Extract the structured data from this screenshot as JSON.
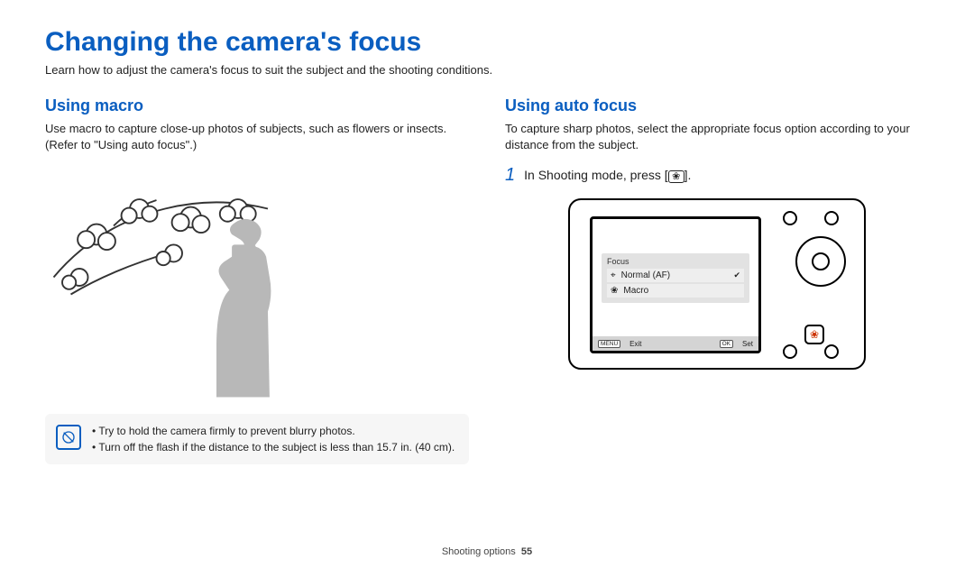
{
  "page": {
    "title": "Changing the camera's focus",
    "subtitle": "Learn how to adjust the camera's focus to suit the subject and the shooting conditions."
  },
  "left": {
    "heading": "Using macro",
    "body": "Use macro to capture close-up photos of subjects, such as flowers or insects. (Refer to \"Using auto focus\".)",
    "tips": [
      "Try to hold the camera firmly to prevent blurry photos.",
      "Turn off the flash if the distance to the subject is less than 15.7 in. (40 cm)."
    ]
  },
  "right": {
    "heading": "Using auto focus",
    "body": "To capture sharp photos, select the appropriate focus option according to your distance from the subject.",
    "step_number": "1",
    "step_text_before": "In Shooting mode, press [",
    "step_text_after": "].",
    "focus_icon_glyph": "❀"
  },
  "camera": {
    "menu_title": "Focus",
    "options": [
      {
        "icon": "⌖",
        "label": "Normal (AF)",
        "selected": true
      },
      {
        "icon": "❀",
        "label": "Macro",
        "selected": false
      }
    ],
    "statusbar": {
      "left_badge": "MENU",
      "left_text": "Exit",
      "right_badge": "OK",
      "right_text": "Set"
    },
    "focus_btn_glyph": "❀"
  },
  "footer": {
    "section": "Shooting options",
    "page_number": "55"
  }
}
